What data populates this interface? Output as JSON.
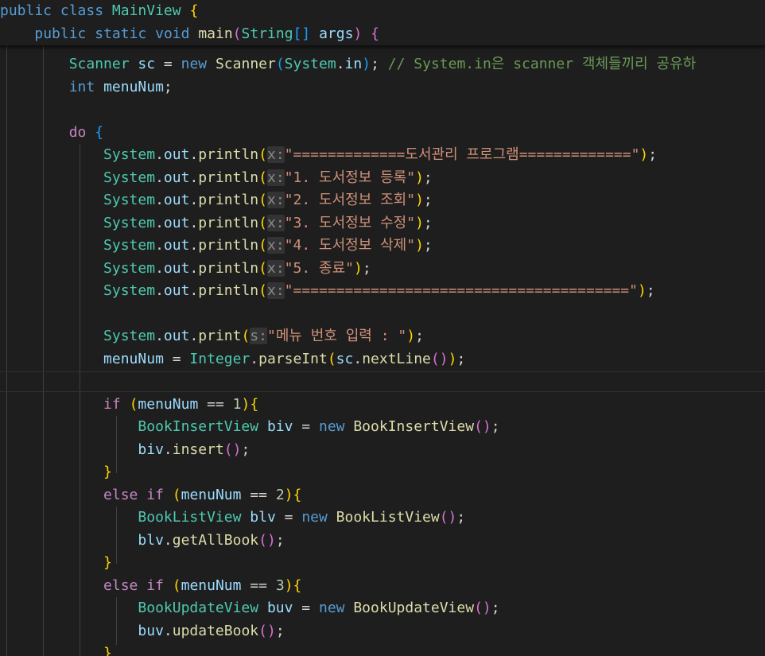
{
  "editor": {
    "theme_colors": {
      "background": "#1e1e1e",
      "keyword": "#569cd6",
      "control": "#c586c0",
      "type": "#4ec9b0",
      "function": "#dcdcaa",
      "variable": "#9cdcfe",
      "string": "#ce9178",
      "number": "#b5cea8",
      "comment": "#6a9955",
      "bracket_1": "#ffd700",
      "bracket_2": "#da70d6",
      "bracket_3": "#179fff"
    },
    "sticky_lines": [
      [
        [
          "kw",
          "public"
        ],
        [
          "",
          " "
        ],
        [
          "kw",
          "class"
        ],
        [
          "",
          " "
        ],
        [
          "ty",
          "MainView"
        ],
        [
          "",
          " "
        ],
        [
          "p1",
          "{"
        ]
      ],
      [
        [
          "",
          "    "
        ],
        [
          "kw",
          "public"
        ],
        [
          "",
          " "
        ],
        [
          "kw",
          "static"
        ],
        [
          "",
          " "
        ],
        [
          "kw",
          "void"
        ],
        [
          "",
          " "
        ],
        [
          "fn",
          "main"
        ],
        [
          "p2",
          "("
        ],
        [
          "ty",
          "String"
        ],
        [
          "p3",
          "[]"
        ],
        [
          "",
          " "
        ],
        [
          "var",
          "args"
        ],
        [
          "p2",
          ")"
        ],
        [
          "",
          " "
        ],
        [
          "p2",
          "{"
        ]
      ]
    ],
    "lines": [
      [
        [
          "",
          "        "
        ],
        [
          "ty",
          "Scanner"
        ],
        [
          "",
          " "
        ],
        [
          "var",
          "sc"
        ],
        [
          "",
          " = "
        ],
        [
          "kw",
          "new"
        ],
        [
          "",
          " "
        ],
        [
          "fn",
          "Scanner"
        ],
        [
          "p3",
          "("
        ],
        [
          "ty",
          "System"
        ],
        [
          "",
          ""
        ],
        [
          ".",
          ""
        ],
        [
          "var",
          "in"
        ],
        [
          "p3",
          ")"
        ],
        [
          "",
          "; "
        ],
        [
          "cm",
          "// System.in은 scanner 객체들끼리 공유하"
        ]
      ],
      [
        [
          "",
          "        "
        ],
        [
          "kw",
          "int"
        ],
        [
          "",
          " "
        ],
        [
          "var",
          "menuNum"
        ],
        [
          "",
          ";"
        ]
      ],
      [],
      [
        [
          "",
          "        "
        ],
        [
          "ctl",
          "do"
        ],
        [
          "",
          " "
        ],
        [
          "p3",
          "{"
        ]
      ],
      [
        [
          "",
          "            "
        ],
        [
          "ty",
          "System"
        ],
        [
          "",
          "."
        ],
        [
          "var",
          "out"
        ],
        [
          "",
          "."
        ],
        [
          "fn",
          "println"
        ],
        [
          "p1",
          "("
        ],
        [
          "hint",
          "x:"
        ],
        [
          "str",
          "\"=============도서관리 프로그램=============\""
        ],
        [
          "p1",
          ")"
        ],
        [
          "",
          ";"
        ]
      ],
      [
        [
          "",
          "            "
        ],
        [
          "ty",
          "System"
        ],
        [
          "",
          "."
        ],
        [
          "var",
          "out"
        ],
        [
          "",
          "."
        ],
        [
          "fn",
          "println"
        ],
        [
          "p1",
          "("
        ],
        [
          "hint",
          "x:"
        ],
        [
          "str",
          "\"1. 도서정보 등록\""
        ],
        [
          "p1",
          ")"
        ],
        [
          "",
          ";"
        ]
      ],
      [
        [
          "",
          "            "
        ],
        [
          "ty",
          "System"
        ],
        [
          "",
          "."
        ],
        [
          "var",
          "out"
        ],
        [
          "",
          "."
        ],
        [
          "fn",
          "println"
        ],
        [
          "p1",
          "("
        ],
        [
          "hint",
          "x:"
        ],
        [
          "str",
          "\"2. 도서정보 조회\""
        ],
        [
          "p1",
          ")"
        ],
        [
          "",
          ";"
        ]
      ],
      [
        [
          "",
          "            "
        ],
        [
          "ty",
          "System"
        ],
        [
          "",
          "."
        ],
        [
          "var",
          "out"
        ],
        [
          "",
          "."
        ],
        [
          "fn",
          "println"
        ],
        [
          "p1",
          "("
        ],
        [
          "hint",
          "x:"
        ],
        [
          "str",
          "\"3. 도서정보 수정\""
        ],
        [
          "p1",
          ")"
        ],
        [
          "",
          ";"
        ]
      ],
      [
        [
          "",
          "            "
        ],
        [
          "ty",
          "System"
        ],
        [
          "",
          "."
        ],
        [
          "var",
          "out"
        ],
        [
          "",
          "."
        ],
        [
          "fn",
          "println"
        ],
        [
          "p1",
          "("
        ],
        [
          "hint",
          "x:"
        ],
        [
          "str",
          "\"4. 도서정보 삭제\""
        ],
        [
          "p1",
          ")"
        ],
        [
          "",
          ";"
        ]
      ],
      [
        [
          "",
          "            "
        ],
        [
          "ty",
          "System"
        ],
        [
          "",
          "."
        ],
        [
          "var",
          "out"
        ],
        [
          "",
          "."
        ],
        [
          "fn",
          "println"
        ],
        [
          "p1",
          "("
        ],
        [
          "hint",
          "x:"
        ],
        [
          "str",
          "\"5. 종료\""
        ],
        [
          "p1",
          ")"
        ],
        [
          "",
          ";"
        ]
      ],
      [
        [
          "",
          "            "
        ],
        [
          "ty",
          "System"
        ],
        [
          "",
          "."
        ],
        [
          "var",
          "out"
        ],
        [
          "",
          "."
        ],
        [
          "fn",
          "println"
        ],
        [
          "p1",
          "("
        ],
        [
          "hint",
          "x:"
        ],
        [
          "str",
          "\"=======================================\""
        ],
        [
          "p1",
          ")"
        ],
        [
          "",
          ";"
        ]
      ],
      [],
      [
        [
          "",
          "            "
        ],
        [
          "ty",
          "System"
        ],
        [
          "",
          "."
        ],
        [
          "var",
          "out"
        ],
        [
          "",
          "."
        ],
        [
          "fn",
          "print"
        ],
        [
          "p1",
          "("
        ],
        [
          "hint",
          "s:"
        ],
        [
          "str",
          "\"메뉴 번호 입력 : \""
        ],
        [
          "p1",
          ")"
        ],
        [
          "",
          ";"
        ]
      ],
      [
        [
          "",
          "            "
        ],
        [
          "var",
          "menuNum"
        ],
        [
          "",
          " = "
        ],
        [
          "ty",
          "Integer"
        ],
        [
          "",
          "."
        ],
        [
          "fn",
          "parseInt"
        ],
        [
          "p1",
          "("
        ],
        [
          "var",
          "sc"
        ],
        [
          "",
          "."
        ],
        [
          "fn",
          "nextLine"
        ],
        [
          "p2",
          "()"
        ],
        [
          "p1",
          ")"
        ],
        [
          "",
          ";"
        ]
      ],
      [],
      [
        [
          "",
          "            "
        ],
        [
          "ctl",
          "if"
        ],
        [
          "",
          " "
        ],
        [
          "p1",
          "("
        ],
        [
          "var",
          "menuNum"
        ],
        [
          "",
          " == "
        ],
        [
          "num",
          "1"
        ],
        [
          "p1",
          ")"
        ],
        [
          "p1",
          "{"
        ]
      ],
      [
        [
          "",
          "                "
        ],
        [
          "ty",
          "BookInsertView"
        ],
        [
          "",
          " "
        ],
        [
          "var",
          "biv"
        ],
        [
          "",
          " = "
        ],
        [
          "kw",
          "new"
        ],
        [
          "",
          " "
        ],
        [
          "fn",
          "BookInsertView"
        ],
        [
          "p2",
          "()"
        ],
        [
          "",
          ";"
        ]
      ],
      [
        [
          "",
          "                "
        ],
        [
          "var",
          "biv"
        ],
        [
          "",
          "."
        ],
        [
          "fn",
          "insert"
        ],
        [
          "p2",
          "()"
        ],
        [
          "",
          ";"
        ]
      ],
      [
        [
          "",
          "            "
        ],
        [
          "p1",
          "}"
        ]
      ],
      [
        [
          "",
          "            "
        ],
        [
          "ctl",
          "else"
        ],
        [
          "",
          " "
        ],
        [
          "ctl",
          "if"
        ],
        [
          "",
          " "
        ],
        [
          "p1",
          "("
        ],
        [
          "var",
          "menuNum"
        ],
        [
          "",
          " == "
        ],
        [
          "num",
          "2"
        ],
        [
          "p1",
          ")"
        ],
        [
          "p1",
          "{"
        ]
      ],
      [
        [
          "",
          "                "
        ],
        [
          "ty",
          "BookListView"
        ],
        [
          "",
          " "
        ],
        [
          "var",
          "blv"
        ],
        [
          "",
          " = "
        ],
        [
          "kw",
          "new"
        ],
        [
          "",
          " "
        ],
        [
          "fn",
          "BookListView"
        ],
        [
          "p2",
          "()"
        ],
        [
          "",
          ";"
        ]
      ],
      [
        [
          "",
          "                "
        ],
        [
          "var",
          "blv"
        ],
        [
          "",
          "."
        ],
        [
          "fn",
          "getAllBook"
        ],
        [
          "p2",
          "()"
        ],
        [
          "",
          ";"
        ]
      ],
      [
        [
          "",
          "            "
        ],
        [
          "p1",
          "}"
        ]
      ],
      [
        [
          "",
          "            "
        ],
        [
          "ctl",
          "else"
        ],
        [
          "",
          " "
        ],
        [
          "ctl",
          "if"
        ],
        [
          "",
          " "
        ],
        [
          "p1",
          "("
        ],
        [
          "var",
          "menuNum"
        ],
        [
          "",
          " == "
        ],
        [
          "num",
          "3"
        ],
        [
          "p1",
          ")"
        ],
        [
          "p1",
          "{"
        ]
      ],
      [
        [
          "",
          "                "
        ],
        [
          "ty",
          "BookUpdateView"
        ],
        [
          "",
          " "
        ],
        [
          "var",
          "buv"
        ],
        [
          "",
          " = "
        ],
        [
          "kw",
          "new"
        ],
        [
          "",
          " "
        ],
        [
          "fn",
          "BookUpdateView"
        ],
        [
          "p2",
          "()"
        ],
        [
          "",
          ";"
        ]
      ],
      [
        [
          "",
          "                "
        ],
        [
          "var",
          "buv"
        ],
        [
          "",
          "."
        ],
        [
          "fn",
          "updateBook"
        ],
        [
          "p2",
          "()"
        ],
        [
          "",
          ";"
        ]
      ],
      [
        [
          "",
          "            "
        ],
        [
          "p1",
          "}"
        ]
      ]
    ]
  }
}
